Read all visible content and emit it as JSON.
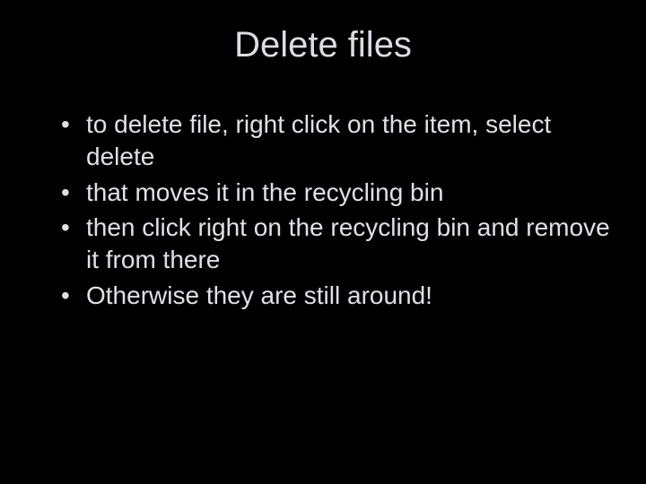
{
  "slide": {
    "title": "Delete files",
    "bullets": [
      "to delete file, right click on the item, select delete",
      "that moves it in the recycling bin",
      "then click right on the recycling bin and remove it from there",
      "Otherwise they are still around!"
    ]
  }
}
